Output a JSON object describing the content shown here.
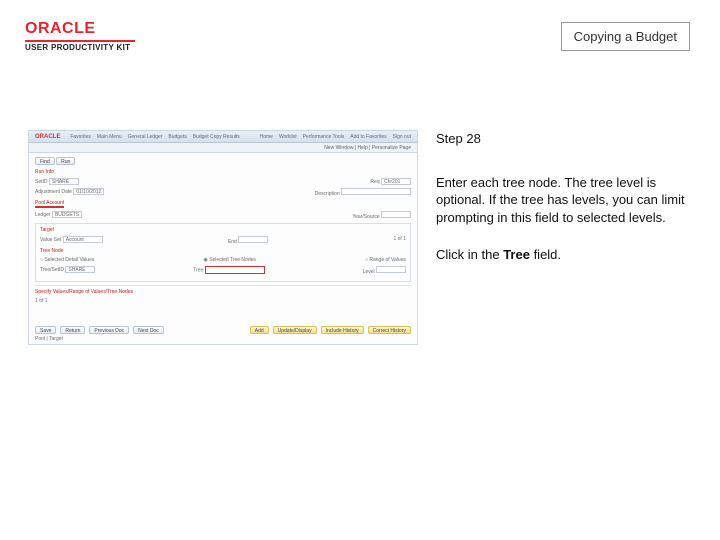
{
  "header": {
    "brand": "ORACLE",
    "kit": "USER PRODUCTIVITY KIT"
  },
  "page_title": "Copying a Budget",
  "instructions": {
    "step_label": "Step 28",
    "paragraph1": "Enter each tree node. The tree level is optional. If the tree has levels, you can limit prompting in this field to selected levels.",
    "click_prefix": "Click in the ",
    "click_field": "Tree",
    "click_suffix": " field."
  },
  "screenshot": {
    "brand": "ORACLE",
    "menu": [
      "Favorites",
      "Main Menu",
      "General Ledger",
      "Budgets",
      "Budget Copy Results"
    ],
    "tabs": [
      "Home",
      "Worklist",
      "Performance Tools",
      "Add to Favorites",
      "Sign out"
    ],
    "subbar": "New Window | Help | Personalize Page",
    "buttons": {
      "find": "Find",
      "run": "Run"
    },
    "sections": {
      "runtime": "Run Info",
      "pool": "Pool Account",
      "target": "Target",
      "specify": "Specify Values/Range of Values/Tree Nodes"
    },
    "fields": {
      "setid": "SetID",
      "setid_val": "SHARE",
      "req": "Req",
      "req_val": "Chr201",
      "app_date": "Adjustment Date",
      "app_date_val": "01/10/2012",
      "descr": "Description",
      "ledger": "Ledger",
      "ledger_val": "BUDGETS",
      "year": "Year/Source",
      "end": "End",
      "acct": "Account",
      "value_set": "Value Set",
      "tree_node": "Tree Node",
      "treeset": "Tree/SetID",
      "treeset_val": "SHARE",
      "tree": "Tree",
      "level": "Level"
    },
    "radios": {
      "selected": "Selected Detail Values",
      "tree": "Selected Tree Nodes",
      "range": "Range of Values"
    },
    "grid_header": "1 of 1",
    "bottom_tabs": [
      "Save",
      "Return",
      "Previous Doc",
      "Next Doc",
      "Add",
      "Update/Display",
      "Include History",
      "Correct History"
    ],
    "corner": "Pool | Target"
  }
}
